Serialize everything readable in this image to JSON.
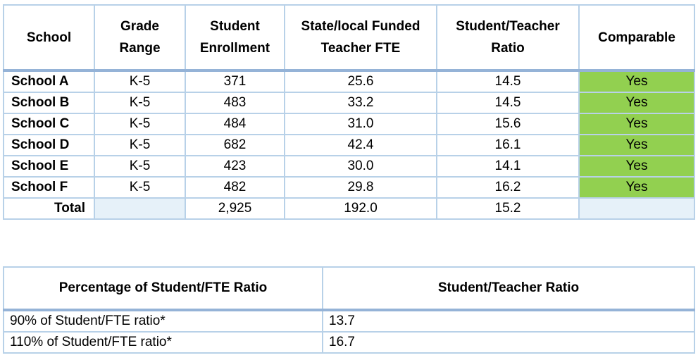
{
  "comparability_table": {
    "headers": [
      "School",
      "Grade Range",
      "Student Enrollment",
      "State/local Funded Teacher FTE",
      "Student/Teacher Ratio",
      "Comparable"
    ],
    "rows": [
      {
        "school": "School A",
        "grade_range": "K-5",
        "enrollment": "371",
        "fte": "25.6",
        "ratio": "14.5",
        "comparable": "Yes"
      },
      {
        "school": "School B",
        "grade_range": "K-5",
        "enrollment": "483",
        "fte": "33.2",
        "ratio": "14.5",
        "comparable": "Yes"
      },
      {
        "school": "School C",
        "grade_range": "K-5",
        "enrollment": "484",
        "fte": "31.0",
        "ratio": "15.6",
        "comparable": "Yes"
      },
      {
        "school": "School D",
        "grade_range": "K-5",
        "enrollment": "682",
        "fte": "42.4",
        "ratio": "16.1",
        "comparable": "Yes"
      },
      {
        "school": "School E",
        "grade_range": "K-5",
        "enrollment": "423",
        "fte": "30.0",
        "ratio": "14.1",
        "comparable": "Yes"
      },
      {
        "school": "School F",
        "grade_range": "K-5",
        "enrollment": "482",
        "fte": "29.8",
        "ratio": "16.2",
        "comparable": "Yes"
      }
    ],
    "total": {
      "label": "Total",
      "enrollment": "2,925",
      "fte": "192.0",
      "ratio": "15.2"
    },
    "colors": {
      "comparable_yes": "#92d050",
      "shaded_cell": "#e6f1f9",
      "border": "#b8d1e8"
    }
  },
  "threshold_table": {
    "headers": [
      "Percentage of Student/FTE Ratio",
      "Student/Teacher Ratio"
    ],
    "rows": [
      {
        "label": "90% of Student/FTE ratio*",
        "value": "13.7"
      },
      {
        "label": "110% of Student/FTE ratio*",
        "value": "16.7"
      }
    ]
  }
}
